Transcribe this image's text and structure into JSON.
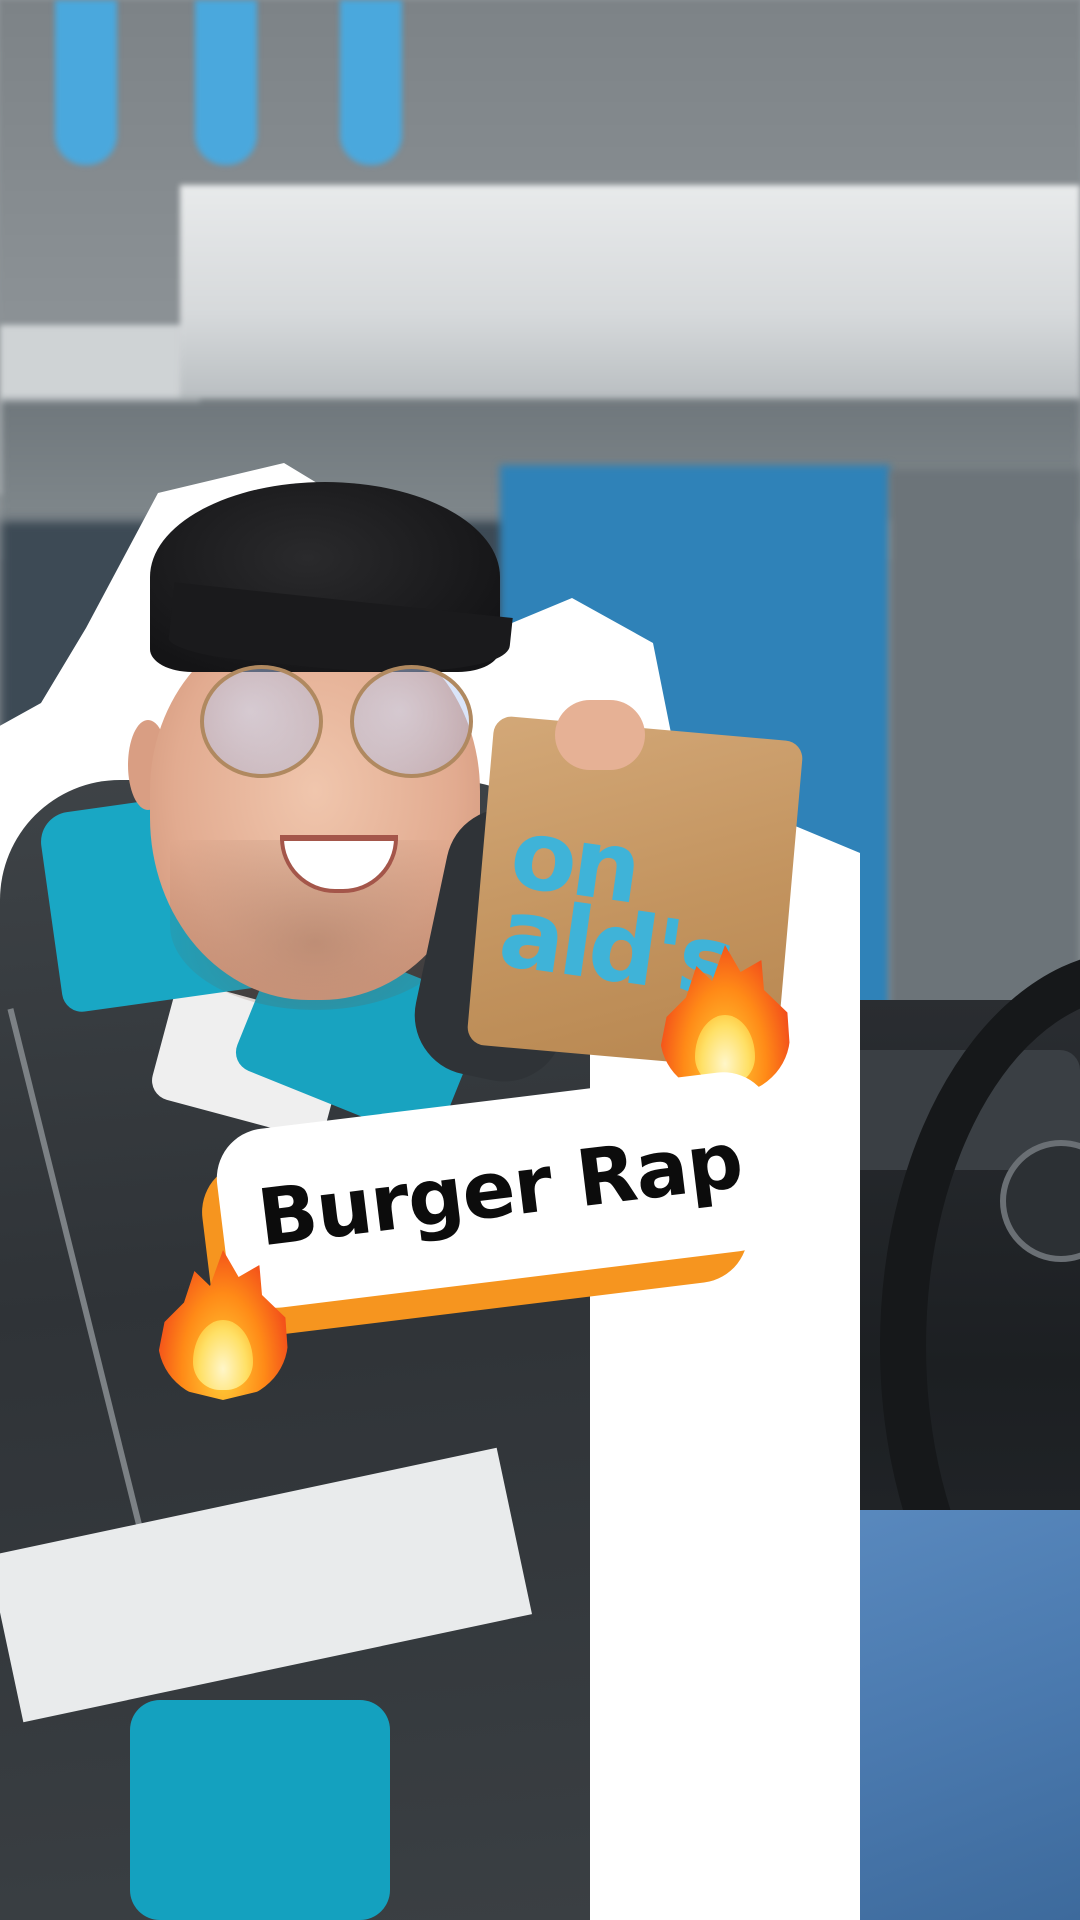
{
  "overlay": {
    "title": "Burger Rap"
  },
  "colors": {
    "title_pill": "#ffffff",
    "title_accent": "#f6951f",
    "title_text": "#0c0c0c"
  },
  "icons": {
    "fire_top": "fire-emoji-icon",
    "fire_bottom": "fire-emoji-icon"
  },
  "bag": {
    "print": "on ald's"
  }
}
